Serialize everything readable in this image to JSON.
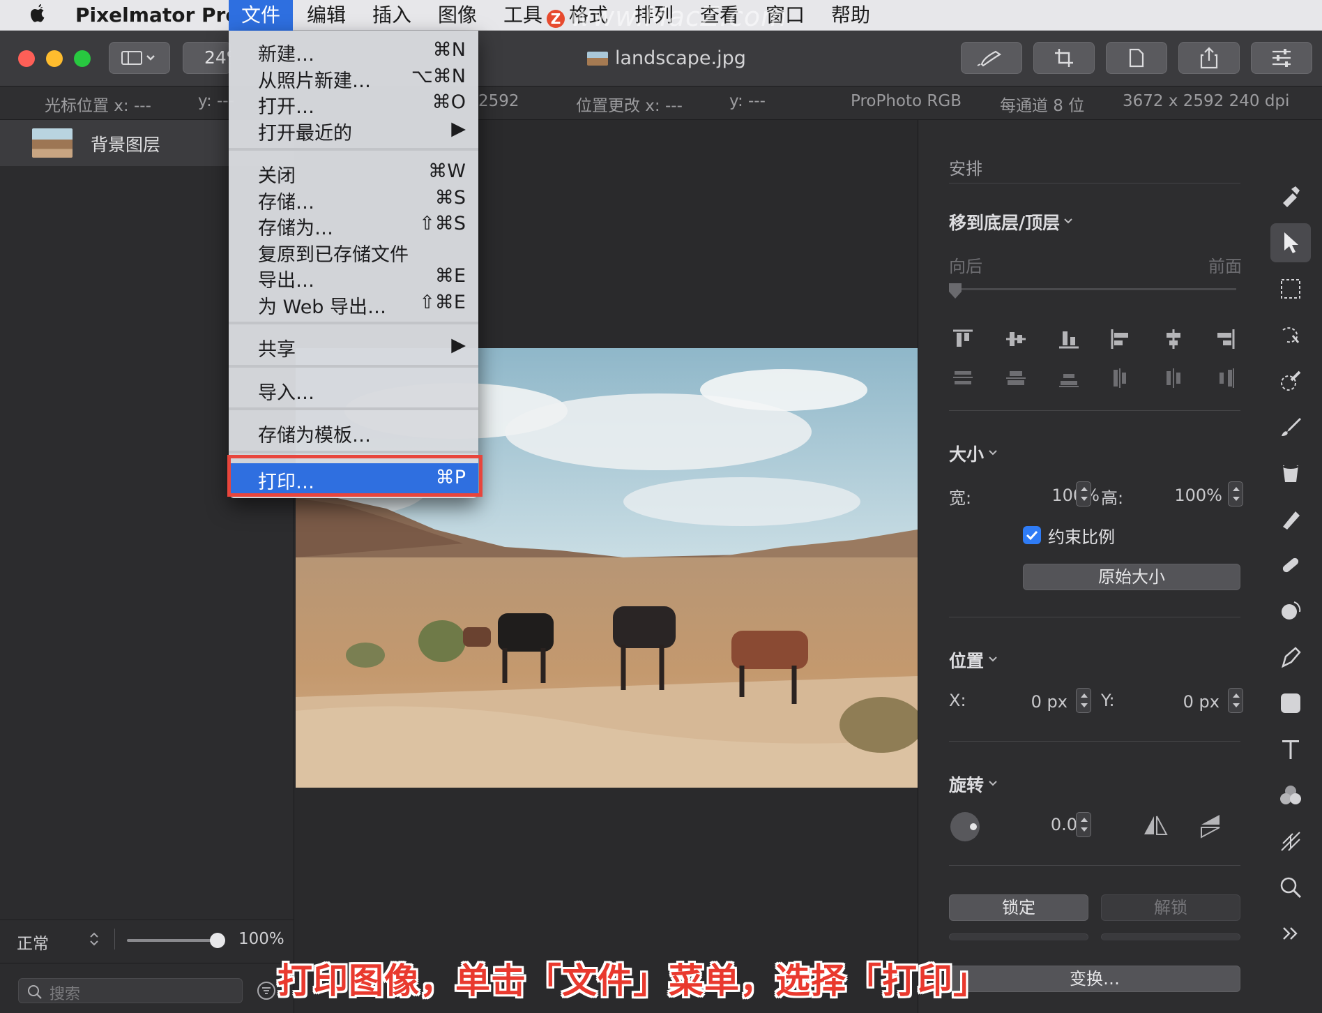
{
  "menubar": {
    "app_name": "Pixelmator Pro",
    "items": [
      "文件",
      "编辑",
      "插入",
      "图像",
      "工具",
      "格式",
      "排列",
      "查看",
      "窗口",
      "帮助"
    ],
    "watermark": "www.MacZ.com",
    "watermark_badge": "Z"
  },
  "toolbar": {
    "zoom": "24%",
    "document_title": "landscape.jpg"
  },
  "infobar": {
    "cursor_x": "光标位置 x:  ---",
    "cursor_y": "y:  ---",
    "size_y_partial": "2592",
    "pos_change_x": "位置更改 x:  ---",
    "pos_change_y": "y:  ---",
    "color_profile": "ProPhoto RGB",
    "bit_depth": "每通道 8 位",
    "dimensions": "3672 x 2592 240 dpi"
  },
  "layers": {
    "layer_name": "背景图层",
    "blend_mode": "正常",
    "opacity": "100%",
    "opacity_level": 1.0,
    "search_placeholder": "搜索"
  },
  "file_menu": {
    "groups": [
      [
        {
          "label": "新建…",
          "shortcut": "⌘N"
        },
        {
          "label": "从照片新建…",
          "shortcut": "⌥⌘N"
        },
        {
          "label": "打开…",
          "shortcut": "⌘O"
        },
        {
          "label": "打开最近的",
          "shortcut": "▶"
        }
      ],
      [
        {
          "label": "关闭",
          "shortcut": "⌘W"
        },
        {
          "label": "存储…",
          "shortcut": "⌘S"
        },
        {
          "label": "存储为…",
          "shortcut": "⇧⌘S"
        },
        {
          "label": "复原到已存储文件",
          "shortcut": ""
        },
        {
          "label": "导出…",
          "shortcut": "⌘E"
        },
        {
          "label": "为 Web 导出…",
          "shortcut": "⇧⌘E"
        }
      ],
      [
        {
          "label": "共享",
          "shortcut": "▶"
        }
      ],
      [
        {
          "label": "导入…",
          "shortcut": ""
        }
      ],
      [
        {
          "label": "存储为模板…",
          "shortcut": ""
        }
      ],
      [
        {
          "label": "打印…",
          "shortcut": "⌘P"
        }
      ]
    ]
  },
  "inspector": {
    "arrange_title": "安排",
    "move_title": "移到底层/顶层",
    "backward": "向后",
    "forward": "前面",
    "size_title": "大小",
    "width_label": "宽:",
    "width_value": "100%",
    "height_label": "高:",
    "height_value": "100%",
    "constrain_label": "约束比例",
    "constrain_checked": true,
    "original_size_button": "原始大小",
    "position_title": "位置",
    "x_label": "X:",
    "x_value": "0 px",
    "y_label": "Y:",
    "y_value": "0 px",
    "rotate_title": "旋转",
    "rotate_value": "0.0°",
    "lock_button": "锁定",
    "unlock_button": "解锁",
    "transform_button": "变换…"
  },
  "caption": "打印图像，单击「文件」菜单，选择「打印」",
  "colors": {
    "menu_highlight": "#2f6fe0",
    "annotation_red": "#e8453c",
    "checkbox_blue": "#2f7cf6"
  }
}
